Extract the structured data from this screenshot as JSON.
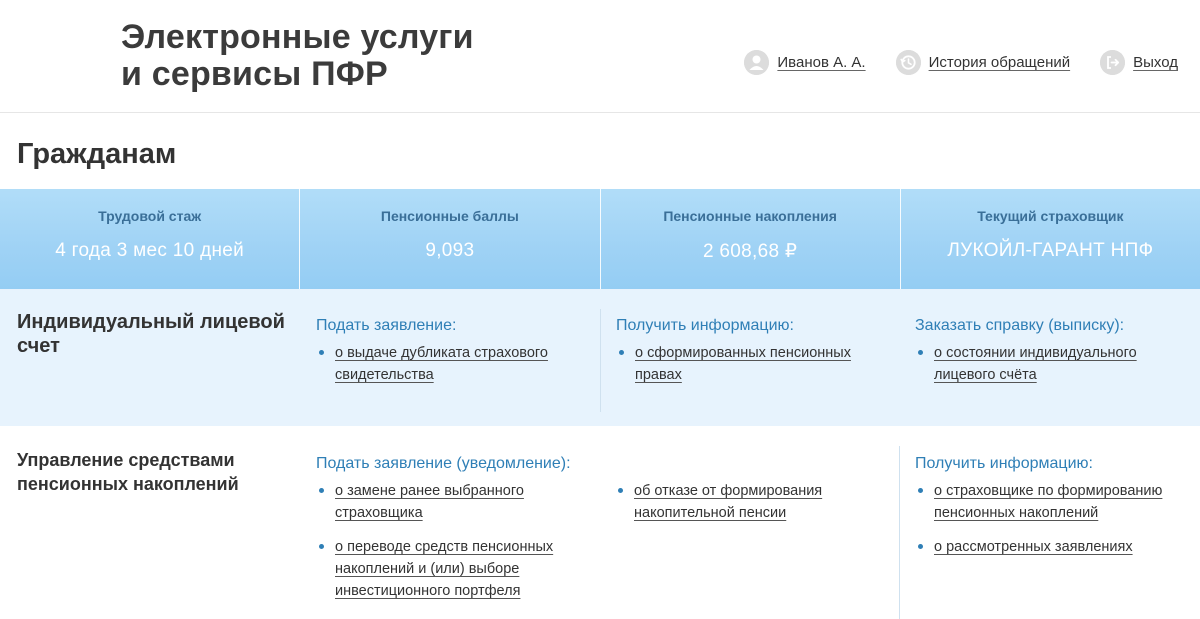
{
  "header": {
    "title_line1": "Электронные услуги",
    "title_line2": "и сервисы ПФР",
    "nav": [
      {
        "label": "Иванов А. А.",
        "icon": "user-icon"
      },
      {
        "label": "История обращений",
        "icon": "history-icon"
      },
      {
        "label": "Выход",
        "icon": "logout-icon"
      }
    ]
  },
  "page": {
    "title": "Гражданам"
  },
  "stats": [
    {
      "label": "Трудовой стаж",
      "value": "4 года 3 мес 10 дней"
    },
    {
      "label": "Пенсионные баллы",
      "value": "9,093"
    },
    {
      "label": "Пенсионные накопления",
      "value": "2 608,68 ₽"
    },
    {
      "label": "Текущий страховщик",
      "value": "ЛУКОЙЛ-ГАРАНТ НПФ"
    }
  ],
  "sections": [
    {
      "title": "Индивидуальный лицевой счет",
      "columns": [
        {
          "heading": "Подать заявление:",
          "links": [
            "о выдаче дубликата страхового свидетельства"
          ]
        },
        {
          "heading": "Получить информацию:",
          "links": [
            "о сформированных пенсионных правах"
          ]
        },
        {
          "heading": "Заказать справку (выписку):",
          "links": [
            "о состоянии индивидуального лицевого счёта"
          ]
        }
      ]
    },
    {
      "title": "Управление средствами пенсионных накоплений",
      "columns": [
        {
          "heading": "Подать заявление (уведомление):",
          "links": [
            "о замене ранее выбранного страховщика",
            "о переводе средств пенсионных накоплений и (или) выборе инвестиционного портфеля"
          ]
        },
        {
          "heading": "",
          "links": [
            "об отказе от формирования накопительной пенсии"
          ]
        },
        {
          "heading": "Получить информацию:",
          "links": [
            "о страховщике по формированию пенсионных накоплений",
            "о рассмотренных заявлениях"
          ]
        }
      ]
    }
  ],
  "colors": {
    "accent": "#2f7fb6",
    "stats_bg": "#9fd2f5",
    "stats_label": "#3a6f98",
    "section_bg": "#e7f3fd"
  }
}
